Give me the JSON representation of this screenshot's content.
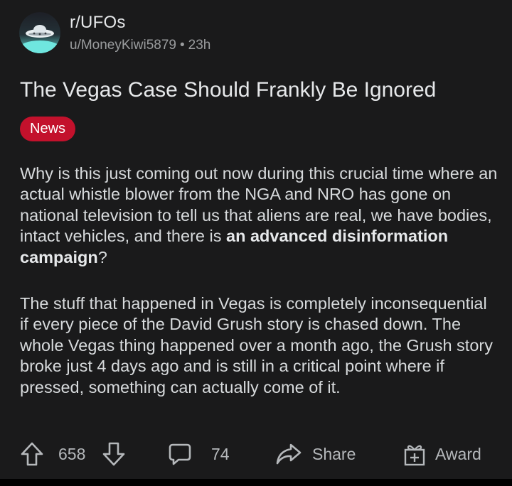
{
  "post": {
    "subreddit": "r/UFOs",
    "author": "u/MoneyKiwi5879",
    "separator": "•",
    "age": "23h",
    "title": "The Vegas Case Should Frankly Be Ignored",
    "flair": "News",
    "body": {
      "p1_text": "Why is this just coming out now during this crucial time where an actual whistle blower from the NGA and NRO has gone on national television to tell us that aliens are real, we have bodies, intact vehicles, and there is ",
      "p1_bold": "an advanced disinformation campaign",
      "p1_end": "?",
      "p2": "The stuff that happened in Vegas is completely inconsequential if every piece of the David Grush story is chased down. The whole Vegas thing happened over a month ago, the Grush story broke just 4 days ago and is still in a critical point where if pressed, something can actually come of it."
    }
  },
  "actions": {
    "upvotes": "658",
    "comments": "74",
    "share_label": "Share",
    "award_label": "Award"
  },
  "colors": {
    "background": "#1a1a1b",
    "flair": "#c3112c",
    "text": "#d7dadc",
    "muted": "#9a9c9e"
  },
  "icons": {
    "avatar": "ufo-subreddit-avatar",
    "upvote": "upvote-arrow-icon",
    "downvote": "downvote-arrow-icon",
    "comment": "comment-bubble-icon",
    "share": "share-arrow-icon",
    "award": "gift-award-icon"
  }
}
